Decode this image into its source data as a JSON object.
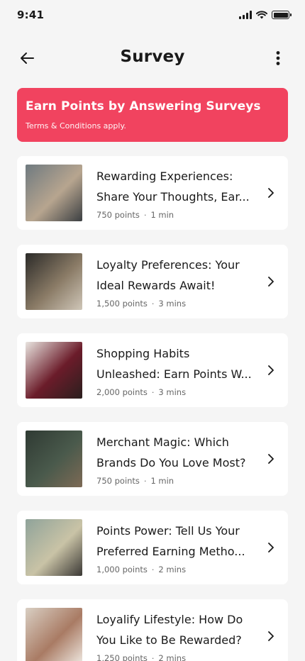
{
  "status": {
    "time": "9:41"
  },
  "header": {
    "title": "Survey",
    "back_icon": "arrow-left-icon",
    "menu_icon": "more-vertical-icon"
  },
  "banner": {
    "title": "Earn Points by Answering Surveys",
    "subtitle": "Terms & Conditions apply.",
    "color": "#f1435f"
  },
  "surveys": [
    {
      "title": "Rewarding Experiences: Share Your Thoughts, Ear...",
      "points": "750 points",
      "duration": "1 min",
      "thumb_colors": [
        "#6f7a80",
        "#b7a58f",
        "#3b3f42"
      ]
    },
    {
      "title": "Loyalty Preferences: Your Ideal Rewards Await!",
      "points": "1,500 points",
      "duration": "3 mins",
      "thumb_colors": [
        "#2b2a28",
        "#8a7b66",
        "#cfc6b8"
      ]
    },
    {
      "title": "Shopping Habits Unleashed: Earn Points W...",
      "points": "2,000 points",
      "duration": "3 mins",
      "thumb_colors": [
        "#e9e5e0",
        "#6b1c2a",
        "#2a1f1e"
      ]
    },
    {
      "title": "Merchant Magic: Which Brands Do You Love Most?",
      "points": "750 points",
      "duration": "1 min",
      "thumb_colors": [
        "#2f3a33",
        "#4a5a4c",
        "#7d6a55"
      ]
    },
    {
      "title": "Points Power: Tell Us Your Preferred Earning Metho...",
      "points": "1,000 points",
      "duration": "2 mins",
      "thumb_colors": [
        "#8fa39a",
        "#c9c3a6",
        "#3b3835"
      ]
    },
    {
      "title": "Loyalify Lifestyle: How Do You Like to Be Rewarded?",
      "points": "1,250 points",
      "duration": "2 mins",
      "thumb_colors": [
        "#d9cfc3",
        "#a97b64",
        "#efe9e2"
      ]
    }
  ]
}
